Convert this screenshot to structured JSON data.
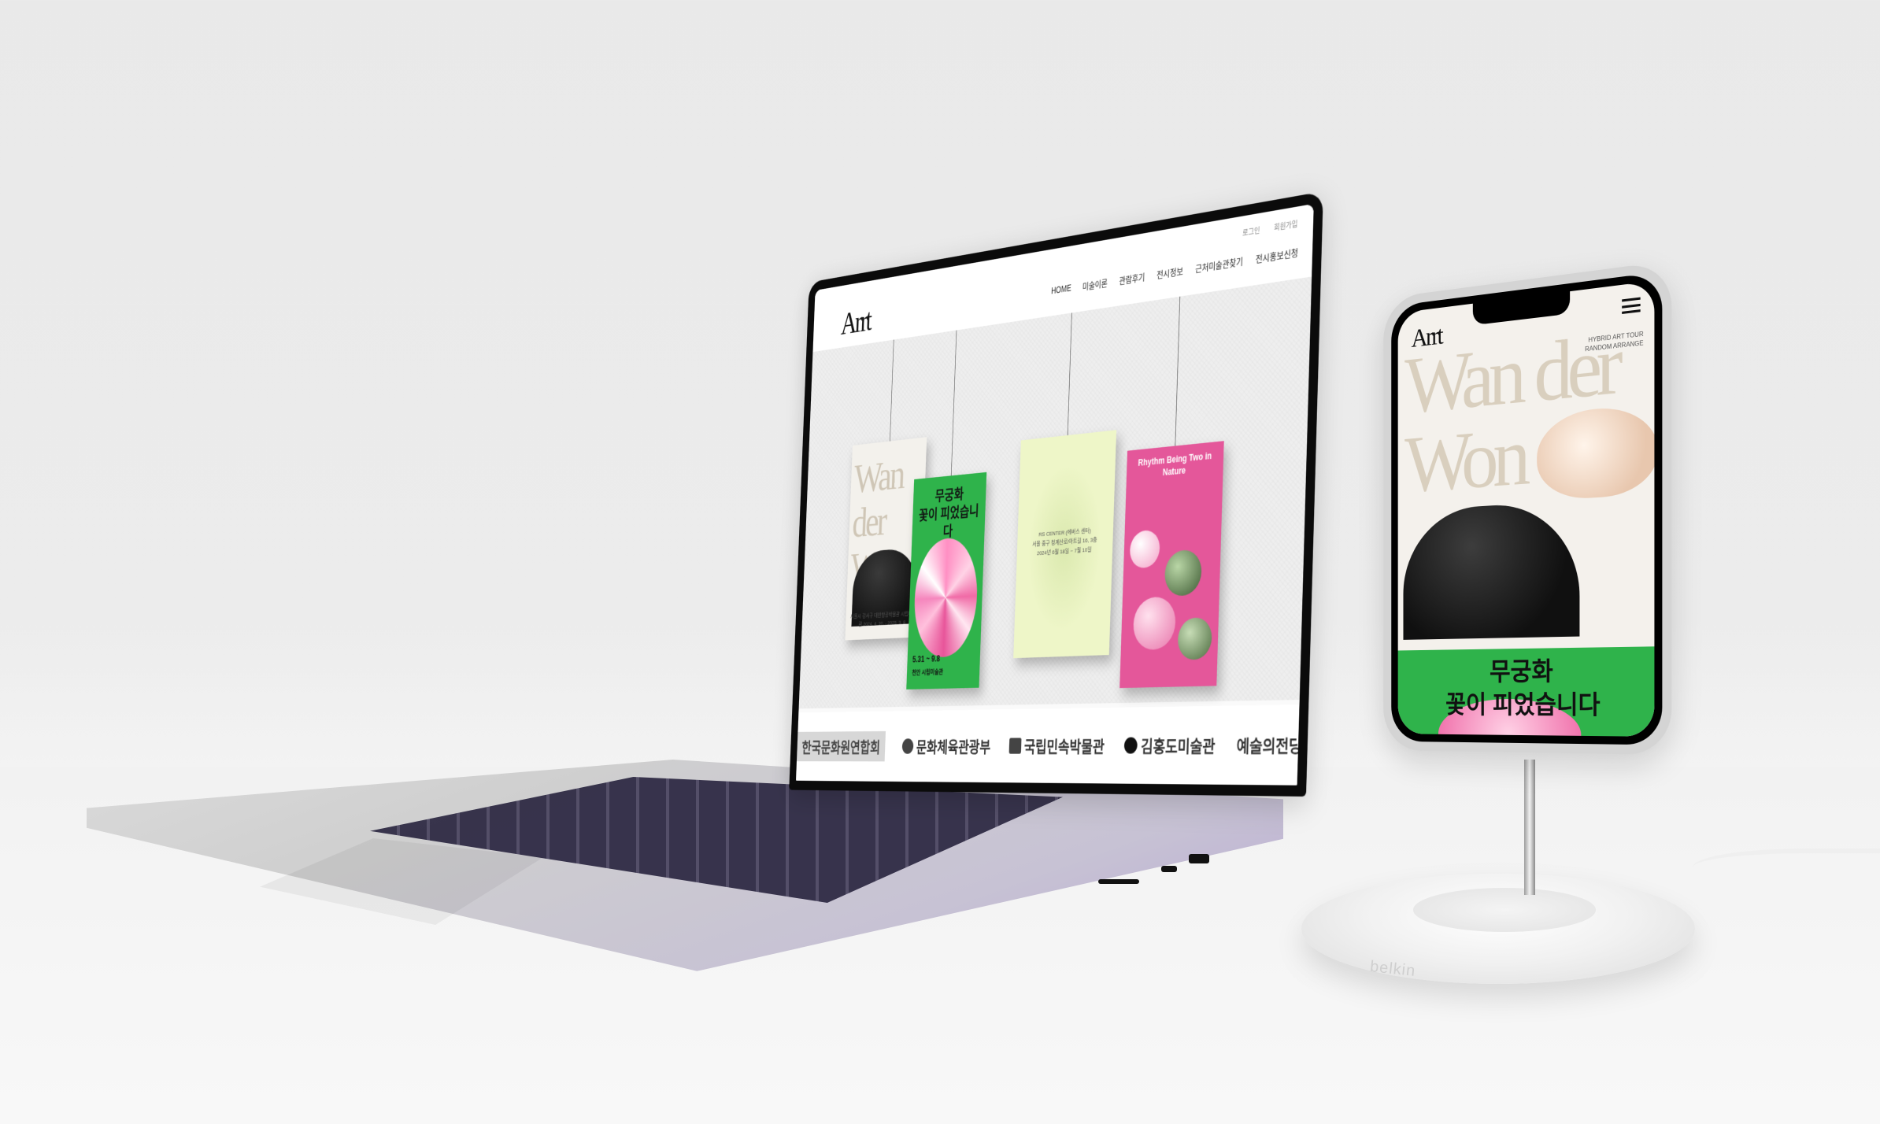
{
  "site": {
    "logo": "Arrt",
    "util_links": [
      "로그인",
      "회원가입"
    ],
    "nav": [
      "HOME",
      "미술이론",
      "관람후기",
      "전시정보",
      "근처미술관찾기",
      "전시홍보신청"
    ]
  },
  "posters": [
    {
      "title": "Wan der Won",
      "caption": "서울시 강서구 대한항공박물관 시립미술관\n2024. 4. 30. - 2025. 3. 8."
    },
    {
      "title": "무궁화\n꽃이 피었습니다",
      "date": "5.31 ~ 9.8",
      "venue": "천안 시립미술관"
    },
    {
      "caption": "RS CENTER (에버스 센터)\n서울 중구 청계산로/아트길 16, 3층\n2024년 6월 18일 ~ 7월 10일"
    },
    {
      "banner": "Rhythm Being Two in Nature"
    }
  ],
  "partners": [
    "한국문화원연합회",
    "문화체육관광부",
    "국립민속박물관",
    "김홍도미술관",
    "예술의전당"
  ],
  "mobile": {
    "logo": "Arrt",
    "hero_title": "Wan der Won",
    "small_text": "HYBRID ART TOUR\nRANDOM ARRANGE",
    "green_title": "무궁화\n꽃이 피었습니다"
  },
  "stand": {
    "brand": "belkin"
  },
  "colors": {
    "green": "#2fb34b",
    "pink": "#e4579a",
    "cream": "#f4f1ec"
  }
}
